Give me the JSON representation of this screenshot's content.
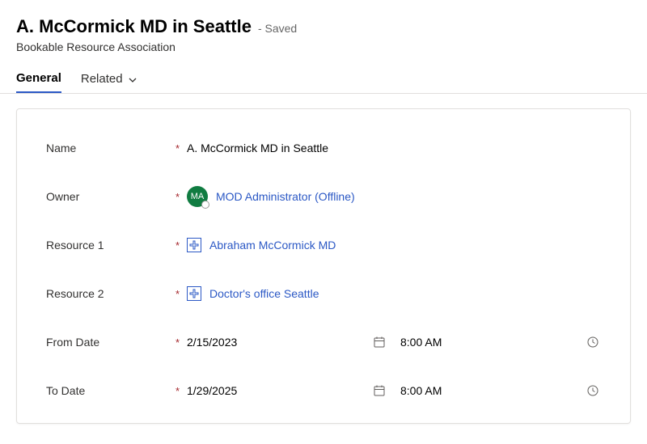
{
  "header": {
    "title": "A. McCormick MD in Seattle",
    "saved_label": "- Saved",
    "subtitle": "Bookable Resource Association"
  },
  "tabs": {
    "general": "General",
    "related": "Related"
  },
  "fields": {
    "name": {
      "label": "Name",
      "value": "A. McCormick MD in Seattle"
    },
    "owner": {
      "label": "Owner",
      "value": "MOD Administrator (Offline)",
      "avatar_initials": "MA"
    },
    "resource1": {
      "label": "Resource 1",
      "value": "Abraham McCormick MD"
    },
    "resource2": {
      "label": "Resource 2",
      "value": "Doctor's office Seattle"
    },
    "from": {
      "label": "From Date",
      "date": "2/15/2023",
      "time": "8:00 AM"
    },
    "to": {
      "label": "To Date",
      "date": "1/29/2025",
      "time": "8:00 AM"
    }
  },
  "required_marker": "*"
}
